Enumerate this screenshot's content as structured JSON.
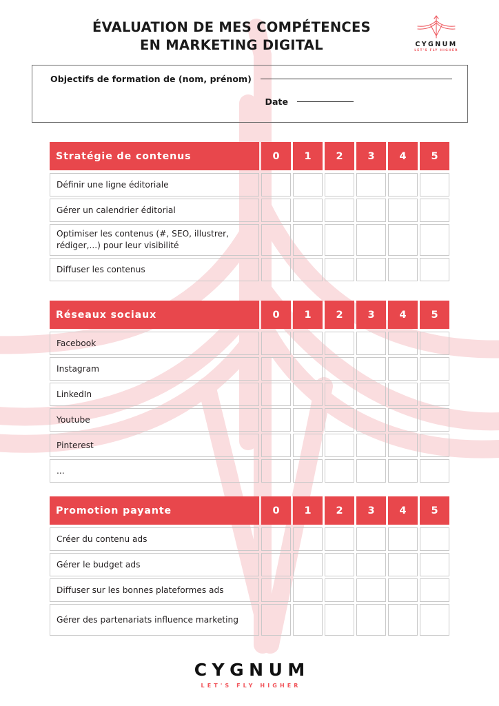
{
  "document": {
    "title_line_1": "ÉVALUATION DE MES COMPÉTENCES",
    "title_line_2": "EN MARKETING DIGITAL",
    "accent_color": "#e8474c",
    "watermark_color": "#fadddf",
    "border_color": "#c9c9c9"
  },
  "brand": {
    "name": "CYGNUM",
    "tagline": "LET'S FLY HIGHER",
    "mark": "crane-logo-icon"
  },
  "objectives": {
    "name_label": "Objectifs de formation de (nom, prénom)",
    "name_value": "",
    "date_label": "Date",
    "date_value": ""
  },
  "scale": [
    "0",
    "1",
    "2",
    "3",
    "4",
    "5"
  ],
  "sections": [
    {
      "title": "Stratégie de contenus",
      "rows": [
        {
          "label": "Définir une ligne éditoriale",
          "tall": false
        },
        {
          "label": "Gérer un calendrier éditorial",
          "tall": false
        },
        {
          "label": "Optimiser les contenus (#, SEO, illustrer, rédiger,...) pour leur visibilité",
          "tall": true
        },
        {
          "label": "Diffuser les contenus",
          "tall": false
        }
      ]
    },
    {
      "title": "Réseaux sociaux",
      "rows": [
        {
          "label": "Facebook",
          "tall": false
        },
        {
          "label": "Instagram",
          "tall": false
        },
        {
          "label": "LinkedIn",
          "tall": false
        },
        {
          "label": "Youtube",
          "tall": false
        },
        {
          "label": "Pinterest",
          "tall": false
        },
        {
          "label": "...",
          "tall": false
        }
      ]
    },
    {
      "title": "Promotion payante",
      "rows": [
        {
          "label": "Créer du contenu ads",
          "tall": false
        },
        {
          "label": "Gérer le budget ads",
          "tall": false
        },
        {
          "label": "Diffuser sur les bonnes plateformes ads",
          "tall": false
        },
        {
          "label": "Gérer des partenariats influence marketing",
          "tall": true
        }
      ]
    }
  ],
  "footer": {
    "name": "CYGNUM",
    "tagline": "LET'S FLY HIGHER"
  }
}
